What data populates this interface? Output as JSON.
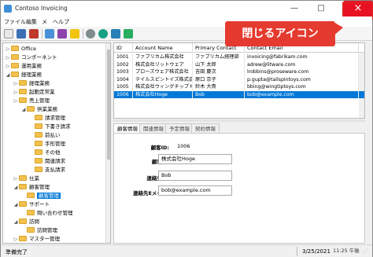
{
  "window": {
    "title": "Contoso Invoicing",
    "min_glyph": "—",
    "max_glyph": "□",
    "close_glyph": "×"
  },
  "callout": {
    "text": "閉じるアイコン"
  },
  "menu": [
    "ファイル",
    "編集",
    "メ",
    "ヘルプ"
  ],
  "tree": {
    "items": [
      {
        "label": "Office",
        "level": 0,
        "exp": "▷"
      },
      {
        "label": "コンポーネント",
        "level": 0,
        "exp": "▷"
      },
      {
        "label": "運用業務",
        "level": 0,
        "exp": "▷"
      },
      {
        "label": "経理業務",
        "level": 0,
        "exp": "◢"
      },
      {
        "label": "経理業務",
        "level": 1,
        "exp": "▷"
      },
      {
        "label": "起動定常業",
        "level": 1,
        "exp": "▷"
      },
      {
        "label": "売上管理",
        "level": 1,
        "exp": "▷"
      },
      {
        "label": "供業業務",
        "level": 2,
        "exp": "◢"
      },
      {
        "label": "請求管理",
        "level": 3,
        "exp": ""
      },
      {
        "label": "下書き請求",
        "level": 3,
        "exp": ""
      },
      {
        "label": "前払い",
        "level": 3,
        "exp": ""
      },
      {
        "label": "手形管理",
        "level": 3,
        "exp": ""
      },
      {
        "label": "その他",
        "level": 3,
        "exp": ""
      },
      {
        "label": "関連請求",
        "level": 3,
        "exp": ""
      },
      {
        "label": "支払請求",
        "level": 3,
        "exp": ""
      },
      {
        "label": "仕業",
        "level": 1,
        "exp": "▷"
      },
      {
        "label": "顧客管理",
        "level": 1,
        "exp": "◢"
      },
      {
        "label": "顧客管理",
        "level": 2,
        "exp": "",
        "selected": true
      },
      {
        "label": "サポート",
        "level": 1,
        "exp": "◢"
      },
      {
        "label": "問い合わせ管理",
        "level": 2,
        "exp": ""
      },
      {
        "label": "訪問",
        "level": 1,
        "exp": "◢"
      },
      {
        "label": "訪問管理",
        "level": 2,
        "exp": ""
      },
      {
        "label": "マスター管理",
        "level": 1,
        "exp": "▷"
      }
    ]
  },
  "grid": {
    "columns": [
      "ID",
      "Account Name",
      "Primary Contact",
      "Contact Email"
    ],
    "rows": [
      [
        "1001",
        "ファブリカム株式会社",
        "ファブリカム経理部",
        "invoicing@fabrikam.com"
      ],
      [
        "1002",
        "株式会社リットウェア",
        "山下 太郎",
        "adrew@litware.com"
      ],
      [
        "1003",
        "プローズウェア株式会社",
        "吉田 慶次",
        "lrobbins@proseware.com"
      ],
      [
        "1004",
        "テイルスピントイズ株式会社",
        "原口 京子",
        "p.gupta@tailspintoys.com"
      ],
      [
        "1005",
        "株式会社ウィングチップトイズ",
        "鈴木 大貴",
        "bbing@wingtiptoys.com"
      ],
      [
        "1006",
        "株式会社Hoge",
        "Bob",
        "bob@example.com"
      ]
    ],
    "selected_row": 5
  },
  "tabs": [
    "顧客情報",
    "関連情報",
    "予定情報",
    "契約情報"
  ],
  "detail": {
    "id_label": "顧客ID:",
    "id_value": "1006",
    "name_label": "顧客名:",
    "name_value": "株式会社Hoge",
    "contact_label": "連絡先名:",
    "contact_value": "Bob",
    "email_label": "連絡先Eメール:",
    "email_value": "bob@example.com"
  },
  "status": {
    "text": "準備完了",
    "date": "3/25/2021",
    "clock": "11:25 午後"
  },
  "colors": {
    "accent": "#0078d7",
    "close_red": "#e81123",
    "callout_red": "#e53a2f"
  }
}
